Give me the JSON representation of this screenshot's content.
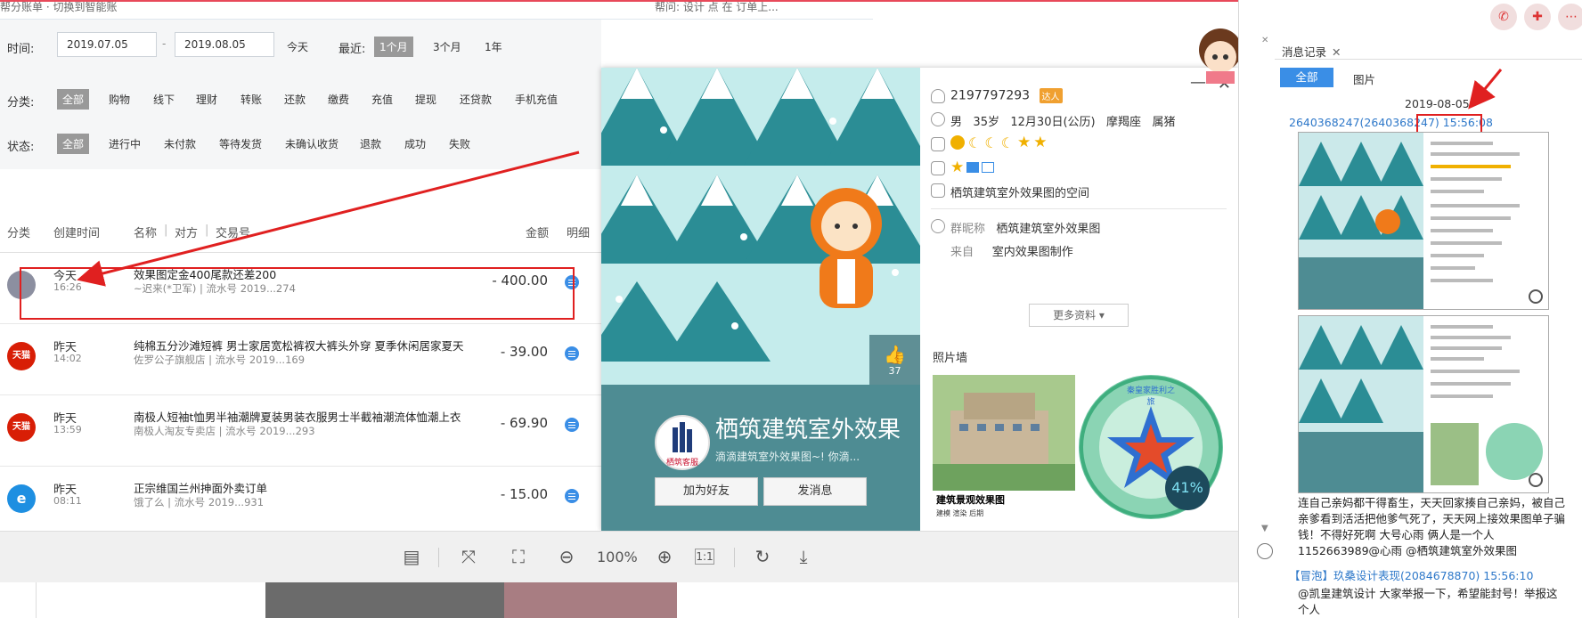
{
  "topstrip": {
    "left_text": "帮分账单 · 切换到智能账",
    "right_text": "帮问: 设计 点 在 订单上..."
  },
  "filters": {
    "time_label": "时间:",
    "date_from": "2019.07.05",
    "date_sep": "-",
    "date_to": "2019.08.05",
    "today": "今天",
    "recent_label": "最近:",
    "recent_options": [
      "1个月",
      "3个月",
      "1年"
    ],
    "category_label": "分类:",
    "categories": [
      "全部",
      "购物",
      "线下",
      "理财",
      "转账",
      "还款",
      "缴费",
      "充值",
      "提现",
      "还贷款",
      "手机充值"
    ],
    "status_label": "状态:",
    "statuses": [
      "全部",
      "进行中",
      "未付款",
      "等待发货",
      "未确认收货",
      "退款",
      "成功",
      "失败"
    ]
  },
  "list_head": {
    "category": "分类",
    "created": "创建时间",
    "name": "名称",
    "party": "对方",
    "txn": "交易号",
    "amount": "金额",
    "detail": "明细"
  },
  "rows": [
    {
      "day": "今天",
      "time": "16:26",
      "name": "效果图定金400尾款还差200",
      "sub": "~迟来(*卫军) | 流水号 2019...274",
      "amount": "- 400.00",
      "icon": "",
      "icon_color": "#8c8fa0"
    },
    {
      "day": "昨天",
      "time": "14:02",
      "name": "纯棉五分沙滩短裤 男士家居宽松裤衩大裤头外穿 夏季休闲居家夏天",
      "sub": "佐罗公子旗舰店 | 流水号 2019...169",
      "amount": "- 39.00",
      "icon": "天猫",
      "icon_color": "#d81e06"
    },
    {
      "day": "昨天",
      "time": "13:59",
      "name": "南极人短袖t恤男半袖潮牌夏装男装衣服男士半截袖潮流体恤潮上衣",
      "sub": "南极人淘友专卖店 | 流水号 2019...293",
      "amount": "- 69.90",
      "icon": "天猫",
      "icon_color": "#d81e06"
    },
    {
      "day": "昨天",
      "time": "08:11",
      "name": "正宗维国兰州抻面外卖订单",
      "sub": "饿了么 | 流水号 2019...931",
      "amount": "- 15.00",
      "icon": "e",
      "icon_color": "#1e8fe1"
    }
  ],
  "toolbar": {
    "zoom": "100%",
    "actual_size": "1:1"
  },
  "card": {
    "qq": "2197797293",
    "qq_badge": "达人",
    "gender": "男",
    "age": "35岁",
    "birthday": "12月30日(公历)",
    "zodiac": "摩羯座",
    "animal": "属猪",
    "space": "栖筑建筑室外效果图的空间",
    "group_nick_label": "群昵称",
    "group_nick": "栖筑建筑室外效果图",
    "from_label": "来自",
    "from": "室内效果图制作",
    "more": "更多资料 ▾",
    "photo_wall": "照片墙",
    "photo1_caption": "建筑景观效果图",
    "photo1_caption2": "建模 渲染 后期",
    "photo2_text": "秦皇家胜利之旅",
    "progress": "41%",
    "cover_name": "栖筑建筑室外效果",
    "cover_sig": "滴滴建筑室外效果图~! 你滴...",
    "avatar_text": "栖筑客服",
    "add_friend": "加为好友",
    "send_msg": "发消息",
    "likes": "37"
  },
  "right_panel": {
    "tab": "消息记录",
    "all": "全部",
    "pictures": "图片",
    "date": "2019-08-05",
    "sender": "2640368247(2640368247)",
    "time": "15:56:08",
    "message": "连自己亲妈都干得畜生，天天回家揍自己亲妈，被自己亲爹看到活活把他爹气死了，天天网上接效果图单子骗钱！不得好死啊 大号心雨 俩人是一个人1152663989@心雨 @栖筑建筑室外效果图",
    "sender2": "【冒泡】玖桑设计表现(2084678870) 15:56:10",
    "message2": "@凯皇建筑设计 大家举报一下，希望能封号！举报这个人"
  },
  "colors": {
    "accent": "#3a8ee6",
    "annotation": "#e02020",
    "filter_bg": "#f5f6f7",
    "cover_teal": "#4e8c93"
  },
  "icons": [
    "phone-icon",
    "message-plus-icon",
    "more-icon",
    "gender-icon",
    "birthday-icon",
    "level-icon",
    "space-icon",
    "like-icon",
    "grid-icon",
    "fit-icon",
    "fullscreen-icon",
    "zoom-out-icon",
    "zoom-in-icon",
    "rotate-icon",
    "download-icon",
    "clock-icon"
  ]
}
